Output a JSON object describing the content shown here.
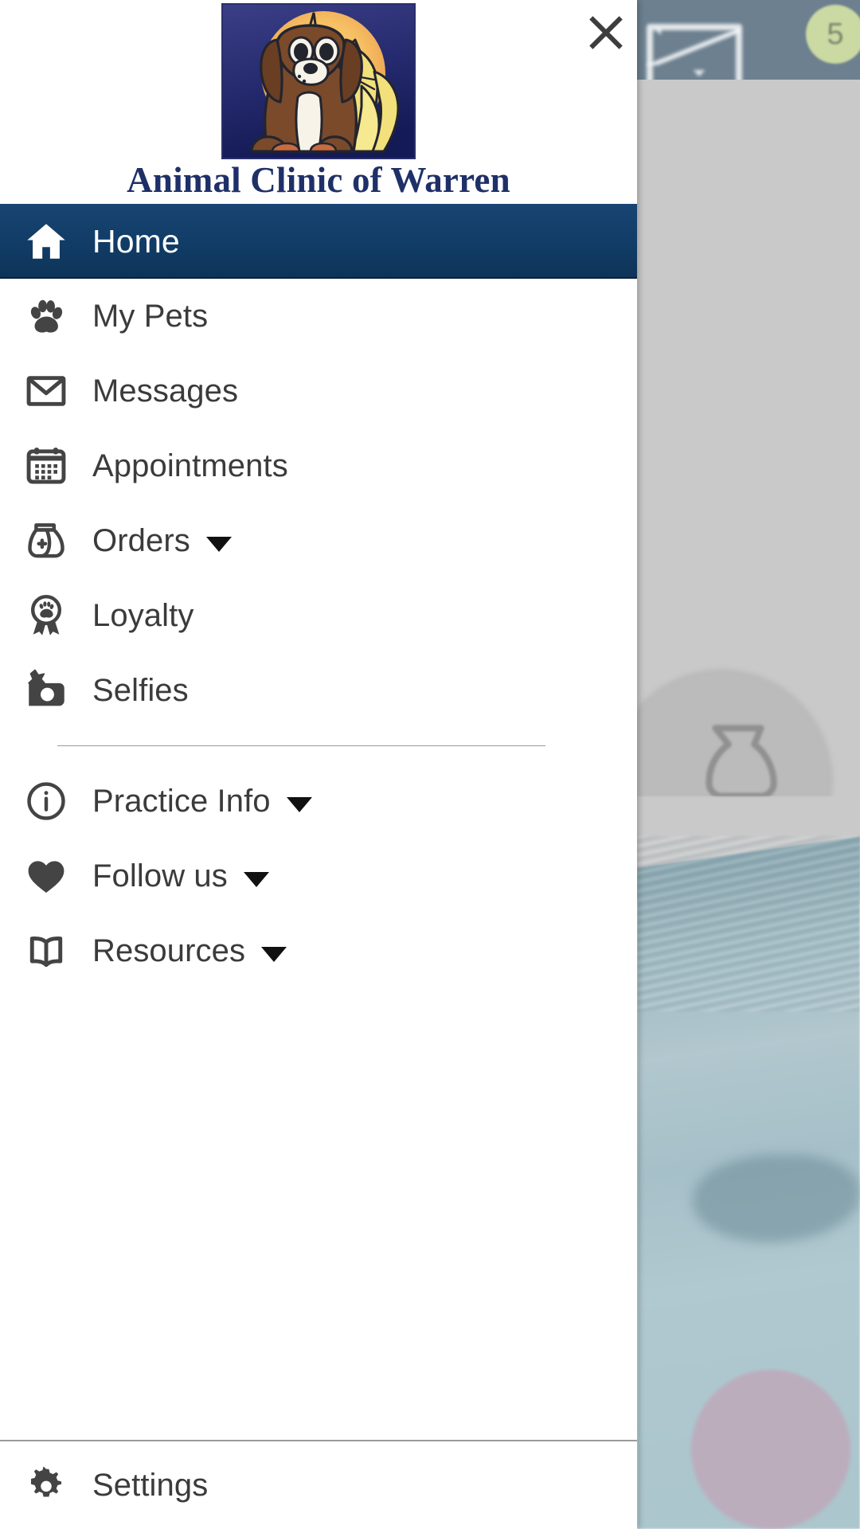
{
  "app": {
    "clinic_name": "Animal Clinic of Warren",
    "logo_alt": "dog-and-cat-logo",
    "accent_navy": "#113c66",
    "title_color": "#1f3068",
    "icon_color": "#444444"
  },
  "header": {
    "close_label": "close-icon"
  },
  "background": {
    "message_badge_count": "5"
  },
  "nav": {
    "primary": [
      {
        "label": "Home",
        "icon": "home-icon",
        "active": true,
        "has_caret": false
      },
      {
        "label": "My Pets",
        "icon": "paw-icon",
        "active": false,
        "has_caret": false
      },
      {
        "label": "Messages",
        "icon": "envelope-icon",
        "active": false,
        "has_caret": false
      },
      {
        "label": "Appointments",
        "icon": "calendar-icon",
        "active": false,
        "has_caret": false
      },
      {
        "label": "Orders",
        "icon": "food-bag-icon",
        "active": false,
        "has_caret": true
      },
      {
        "label": "Loyalty",
        "icon": "award-ribbon-icon",
        "active": false,
        "has_caret": false
      },
      {
        "label": "Selfies",
        "icon": "camera-star-icon",
        "active": false,
        "has_caret": false
      }
    ],
    "secondary": [
      {
        "label": "Practice Info",
        "icon": "info-circle-icon",
        "active": false,
        "has_caret": true
      },
      {
        "label": "Follow us",
        "icon": "heart-icon",
        "active": false,
        "has_caret": true
      },
      {
        "label": "Resources",
        "icon": "book-icon",
        "active": false,
        "has_caret": true
      }
    ],
    "footer": [
      {
        "label": "Settings",
        "icon": "gear-icon",
        "active": false,
        "has_caret": false
      }
    ]
  }
}
